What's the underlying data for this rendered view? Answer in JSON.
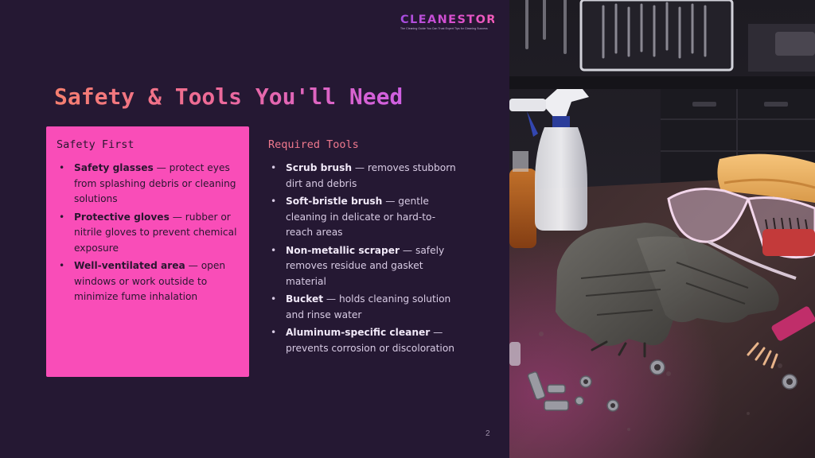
{
  "brand": {
    "name": "CLEANESTOR",
    "tagline": "The Cleaning Guide You Can Trust Expert Tips for Cleaning Success"
  },
  "title": "Safety & Tools You'll Need",
  "safety": {
    "heading": "Safety First",
    "items": [
      {
        "bold": "Safety glasses",
        "text": " — protect eyes from splashing debris or cleaning solutions"
      },
      {
        "bold": "Protective gloves",
        "text": " — rubber or nitrile gloves to prevent chemical exposure"
      },
      {
        "bold": "Well-ventilated area",
        "text": " — open windows or work outside to minimize fume inhalation"
      }
    ]
  },
  "tools": {
    "heading": "Required Tools",
    "items": [
      {
        "bold": "Scrub brush",
        "text": " — removes stubborn dirt and debris"
      },
      {
        "bold": "Soft-bristle brush",
        "text": " — gentle cleaning in delicate or hard-to-reach areas"
      },
      {
        "bold": "Non-metallic scraper",
        "text": " — safely removes residue and gasket material"
      },
      {
        "bold": "Bucket",
        "text": " — holds cleaning solution and rinse water"
      },
      {
        "bold": "Aluminum-specific cleaner",
        "text": " — prevents corrosion or discoloration"
      }
    ]
  },
  "bullet": "•",
  "page_number": "2",
  "colors": {
    "background": "#251833",
    "card": "#f94db8",
    "title_start": "#f57f6f",
    "title_end": "#cf5fe3",
    "tools_heading": "#f0798e"
  }
}
